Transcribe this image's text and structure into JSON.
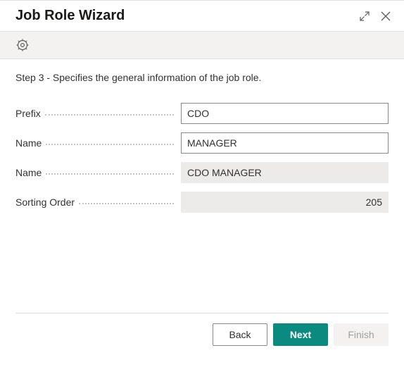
{
  "header": {
    "title": "Job Role Wizard"
  },
  "step_text": "Step 3 - Specifies the general information of the job role.",
  "form": {
    "prefix": {
      "label": "Prefix",
      "value": "CDO"
    },
    "name": {
      "label": "Name",
      "value": "MANAGER"
    },
    "full_name": {
      "label": "Name",
      "value": "CDO MANAGER"
    },
    "sorting_order": {
      "label": "Sorting Order",
      "value": "205"
    }
  },
  "buttons": {
    "back": "Back",
    "next": "Next",
    "finish": "Finish"
  }
}
